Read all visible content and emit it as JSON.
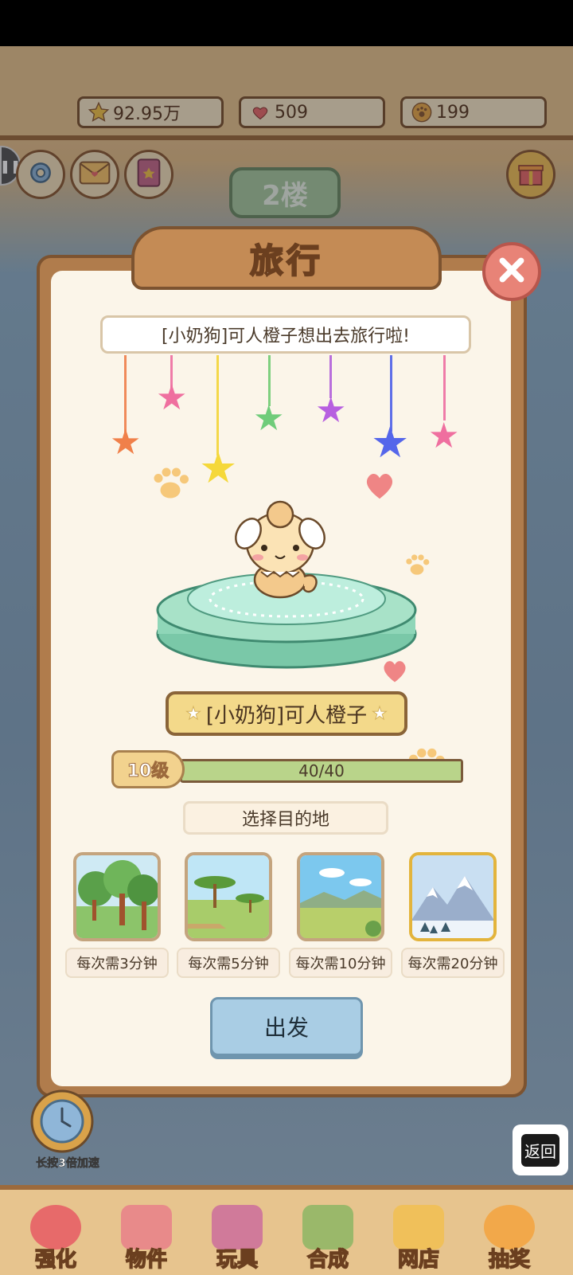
{
  "resources": {
    "stars": "92.95万",
    "hearts": "509",
    "coins": "199"
  },
  "floor": "2楼",
  "dialog": {
    "title": "旅行",
    "message": "[小奶狗]可人橙子想出去旅行啦!",
    "pet_name": "[小奶狗]可人橙子",
    "level_label": "10级",
    "xp_text": "40/40",
    "xp_fraction": 1.0,
    "destination_title": "选择目的地",
    "destinations": [
      {
        "time": "每次需3分钟",
        "scene": "forest",
        "selected": false
      },
      {
        "time": "每次需5分钟",
        "scene": "savanna",
        "selected": false
      },
      {
        "time": "每次需10分钟",
        "scene": "grassland",
        "selected": false
      },
      {
        "time": "每次需20分钟",
        "scene": "snow-mountain",
        "selected": true
      }
    ],
    "go_label": "出发"
  },
  "speed_label": "长按3倍加速",
  "back_label": "返回",
  "nav": [
    {
      "label": "强化"
    },
    {
      "label": "物件"
    },
    {
      "label": "玩具"
    },
    {
      "label": "合成"
    },
    {
      "label": "网店"
    },
    {
      "label": "抽奖"
    }
  ],
  "colors": {
    "dialog_frame": "#b07c4c",
    "dialog_bg": "#fbf5e9",
    "go_button": "#a9cde4",
    "xp_bar": "#b9d48a",
    "selected_border": "#e3b43c"
  }
}
